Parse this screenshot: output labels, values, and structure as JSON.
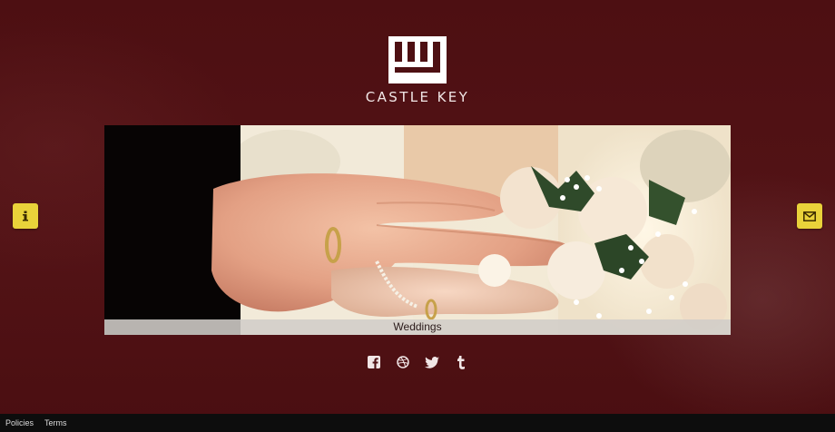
{
  "brand": {
    "name": "CASTLE KEY",
    "logo_icon": "castle-key-logo"
  },
  "hero": {
    "caption": "Weddings",
    "image_subject": "wedding-hands-with-rings-and-bouquet"
  },
  "side_buttons": {
    "left_icon": "info-icon",
    "right_icon": "envelope-icon",
    "color": "#e9d23a"
  },
  "social": [
    {
      "name": "facebook",
      "icon": "facebook-icon"
    },
    {
      "name": "dribbble",
      "icon": "dribbble-icon"
    },
    {
      "name": "twitter",
      "icon": "twitter-icon"
    },
    {
      "name": "tumblr",
      "icon": "tumblr-icon"
    }
  ],
  "footer": {
    "links": [
      "Policies",
      "Terms"
    ]
  },
  "colors": {
    "background": "#4e1013",
    "footer": "#0d0d0d",
    "accent": "#e9d23a"
  }
}
